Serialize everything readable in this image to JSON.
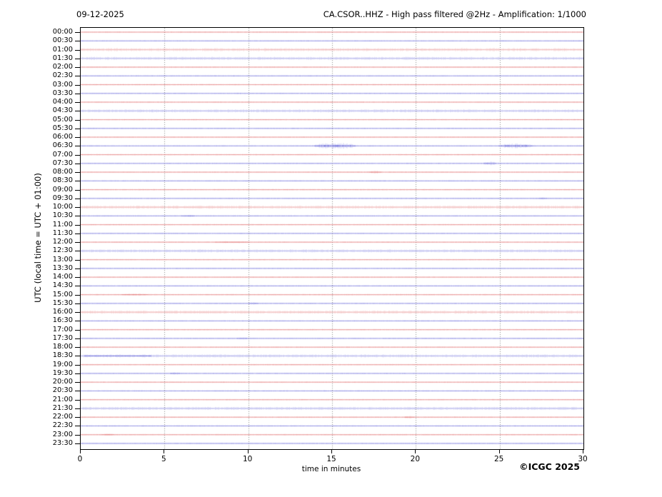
{
  "header": {
    "date": "09-12-2025",
    "title": "CA.CSOR..HHZ - High pass filtered @2Hz - Amplification: 1/1000"
  },
  "y_axis": {
    "title": "UTC (local time = UTC + 01:00)"
  },
  "footer": {
    "xlabel": "time in minutes",
    "copyright": "©ICGC 2025"
  },
  "chart_data": {
    "type": "line",
    "subtype": "helicorder-seismogram",
    "title": "CA.CSOR..HHZ - High pass filtered @2Hz - Amplification: 1/1000",
    "date": "09-12-2025",
    "xlabel": "time in minutes",
    "ylabel": "UTC (local time = UTC + 01:00)",
    "x_range": [
      0,
      30
    ],
    "x_ticks": [
      0,
      5,
      10,
      15,
      20,
      25,
      30
    ],
    "grid_minutes": [
      5,
      10,
      15,
      20,
      25
    ],
    "minutes_per_row": 30,
    "n_rows": 48,
    "grid_on": true,
    "palette": {
      "red": "#dd5c5c",
      "blue": "#5c5cd6",
      "grid": "#8a8a8a",
      "frame": "#000000"
    },
    "rows": [
      {
        "label": "00:00",
        "color": "red",
        "fuzzy": false,
        "events": []
      },
      {
        "label": "00:30",
        "color": "blue",
        "fuzzy": false,
        "events": []
      },
      {
        "label": "01:00",
        "color": "red",
        "fuzzy": true,
        "events": []
      },
      {
        "label": "01:30",
        "color": "blue",
        "fuzzy": true,
        "events": []
      },
      {
        "label": "02:00",
        "color": "red",
        "fuzzy": false,
        "events": []
      },
      {
        "label": "02:30",
        "color": "blue",
        "fuzzy": false,
        "events": []
      },
      {
        "label": "03:00",
        "color": "red",
        "fuzzy": false,
        "events": []
      },
      {
        "label": "03:30",
        "color": "blue",
        "fuzzy": false,
        "events": []
      },
      {
        "label": "04:00",
        "color": "red",
        "fuzzy": false,
        "events": []
      },
      {
        "label": "04:30",
        "color": "blue",
        "fuzzy": true,
        "events": []
      },
      {
        "label": "05:00",
        "color": "red",
        "fuzzy": false,
        "events": []
      },
      {
        "label": "05:30",
        "color": "blue",
        "fuzzy": false,
        "events": []
      },
      {
        "label": "06:00",
        "color": "red",
        "fuzzy": false,
        "events": []
      },
      {
        "label": "06:30",
        "color": "blue",
        "fuzzy": false,
        "events": [
          [
            13.9,
            16.4,
            3.4
          ],
          [
            24.9,
            27.0,
            3.0
          ]
        ]
      },
      {
        "label": "07:00",
        "color": "red",
        "fuzzy": false,
        "events": []
      },
      {
        "label": "07:30",
        "color": "blue",
        "fuzzy": false,
        "events": [
          [
            24.0,
            24.8,
            2.2
          ]
        ]
      },
      {
        "label": "08:00",
        "color": "red",
        "fuzzy": false,
        "events": [
          [
            17.2,
            17.9,
            1.6
          ]
        ]
      },
      {
        "label": "08:30",
        "color": "blue",
        "fuzzy": false,
        "events": []
      },
      {
        "label": "09:00",
        "color": "red",
        "fuzzy": false,
        "events": []
      },
      {
        "label": "09:30",
        "color": "blue",
        "fuzzy": false,
        "events": [
          [
            27.3,
            27.8,
            1.3
          ]
        ]
      },
      {
        "label": "10:00",
        "color": "red",
        "fuzzy": true,
        "events": []
      },
      {
        "label": "10:30",
        "color": "blue",
        "fuzzy": false,
        "events": [
          [
            6.0,
            6.8,
            1.2
          ]
        ]
      },
      {
        "label": "11:00",
        "color": "red",
        "fuzzy": false,
        "events": []
      },
      {
        "label": "11:30",
        "color": "blue",
        "fuzzy": false,
        "events": []
      },
      {
        "label": "12:00",
        "color": "red",
        "fuzzy": false,
        "events": [
          [
            8.0,
            10.0,
            1.1
          ]
        ]
      },
      {
        "label": "12:30",
        "color": "blue",
        "fuzzy": true,
        "events": []
      },
      {
        "label": "13:00",
        "color": "red",
        "fuzzy": false,
        "events": []
      },
      {
        "label": "13:30",
        "color": "blue",
        "fuzzy": false,
        "events": []
      },
      {
        "label": "14:00",
        "color": "red",
        "fuzzy": false,
        "events": []
      },
      {
        "label": "14:30",
        "color": "blue",
        "fuzzy": false,
        "events": []
      },
      {
        "label": "15:00",
        "color": "red",
        "fuzzy": false,
        "events": [
          [
            2.4,
            4.0,
            1.3
          ]
        ]
      },
      {
        "label": "15:30",
        "color": "blue",
        "fuzzy": false,
        "events": [
          [
            10.0,
            10.6,
            1.5
          ]
        ]
      },
      {
        "label": "16:00",
        "color": "red",
        "fuzzy": true,
        "events": []
      },
      {
        "label": "16:30",
        "color": "blue",
        "fuzzy": false,
        "events": []
      },
      {
        "label": "17:00",
        "color": "red",
        "fuzzy": false,
        "events": []
      },
      {
        "label": "17:30",
        "color": "blue",
        "fuzzy": false,
        "events": [
          [
            9.3,
            9.9,
            1.3
          ]
        ]
      },
      {
        "label": "18:00",
        "color": "red",
        "fuzzy": false,
        "events": []
      },
      {
        "label": "18:30",
        "color": "blue",
        "fuzzy": true,
        "events": [
          [
            0.2,
            4.2,
            1.1
          ]
        ]
      },
      {
        "label": "19:00",
        "color": "red",
        "fuzzy": false,
        "events": []
      },
      {
        "label": "19:30",
        "color": "blue",
        "fuzzy": false,
        "events": [
          [
            5.3,
            5.9,
            1.4
          ]
        ]
      },
      {
        "label": "20:00",
        "color": "red",
        "fuzzy": false,
        "events": []
      },
      {
        "label": "20:30",
        "color": "blue",
        "fuzzy": false,
        "events": []
      },
      {
        "label": "21:00",
        "color": "red",
        "fuzzy": false,
        "events": []
      },
      {
        "label": "21:30",
        "color": "blue",
        "fuzzy": true,
        "events": []
      },
      {
        "label": "22:00",
        "color": "red",
        "fuzzy": false,
        "events": [
          [
            19.3,
            19.9,
            1.4
          ]
        ]
      },
      {
        "label": "22:30",
        "color": "blue",
        "fuzzy": false,
        "events": []
      },
      {
        "label": "23:00",
        "color": "red",
        "fuzzy": false,
        "events": [
          [
            1.2,
            2.0,
            1.2
          ]
        ]
      },
      {
        "label": "23:30",
        "color": "blue",
        "fuzzy": false,
        "events": []
      }
    ]
  }
}
